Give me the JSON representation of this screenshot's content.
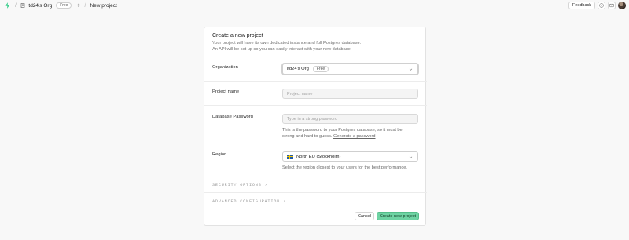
{
  "nav": {
    "org_name": "itd24's Org",
    "org_plan": "Free",
    "page": "New project",
    "feedback": "Feedback"
  },
  "panel": {
    "title": "Create a new project",
    "desc_line1": "Your project will have its own dedicated instance and full Postgres database.",
    "desc_line2": "An API will be set up so you can easily interact with your new database."
  },
  "form": {
    "organization": {
      "label": "Organization",
      "value": "itd24's Org",
      "plan": "Free"
    },
    "project_name": {
      "label": "Project name",
      "placeholder": "Project name"
    },
    "db_password": {
      "label": "Database Password",
      "placeholder": "Type in a strong password",
      "help1": "This is the password to your Postgres database, so it must be",
      "help2": "strong and hard to guess.",
      "generate_link": "Generate a password"
    },
    "region": {
      "label": "Region",
      "value": "North EU (Stockholm)",
      "help": "Select the region closest to your users for the best performance."
    },
    "security_options": "SECURITY OPTIONS  ›",
    "advanced_configuration": "ADVANCED CONFIGURATION  ›"
  },
  "buttons": {
    "cancel": "Cancel",
    "create": "Create new project"
  },
  "colors": {
    "accent": "#6ed3a3",
    "logo": "#3ecf8e"
  }
}
